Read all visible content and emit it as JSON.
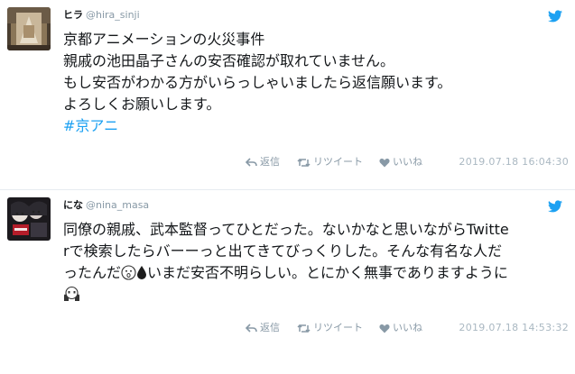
{
  "tweets": [
    {
      "display_name": "ヒラ",
      "handle": "@hira_sinji",
      "lines": [
        "京都アニメーションの火災事件",
        "親戚の池田晶子さんの安否確認が取れていません。",
        "もし安否がわかる方がいらっしゃいましたら返信願います。",
        "よろしくお願いします。"
      ],
      "hashtag": "#京アニ",
      "reply_label": "返信",
      "retweet_label": "リツイート",
      "like_label": "いいね",
      "timestamp": "2019.07.18 16:04:30"
    },
    {
      "display_name": "にな",
      "handle": "@nina_masa",
      "lines": [
        "同僚の親戚、武本監督ってひとだった。ないかなと思いながらTwitte",
        "rで検索したらバーーっと出てきてびっくりした。そんな有名な人だ",
        "ったんだ",
        "いまだ安否不明らしい。とにかく無事でありますように"
      ],
      "reply_label": "返信",
      "retweet_label": "リツイート",
      "like_label": "いいね",
      "timestamp": "2019.07.18 14:53:32"
    }
  ],
  "icons": {
    "twitter": "twitter-bird-icon",
    "reply": "reply-icon",
    "retweet": "retweet-icon",
    "like": "heart-icon",
    "emoji_1": "astonished-face-emoji",
    "emoji_2": "droplet-emoji",
    "emoji_3": "pleading-hands-face-emoji"
  },
  "colors": {
    "hashtag": "#1da1f2",
    "bird": "#1da1f2",
    "muted": "#8899a6"
  }
}
